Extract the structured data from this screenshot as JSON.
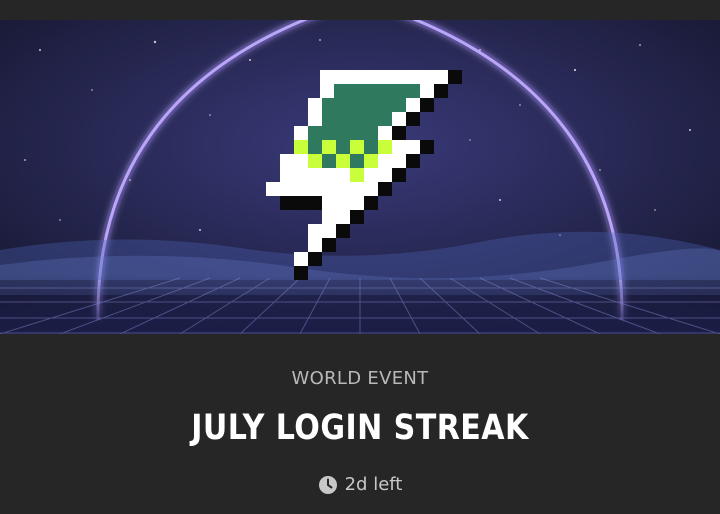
{
  "event": {
    "category": "WORLD EVENT",
    "title": "JULY LOGIN STREAK",
    "time_left": "2d left",
    "time_icon": "clock-icon"
  },
  "banner": {
    "icon": "lightning-bolt-icon",
    "colors": {
      "sky_top": "#1a1c3a",
      "sky_mid": "#2c2c66",
      "arc_glow": "#c7b8ff",
      "bolt_white": "#ffffff",
      "bolt_teal": "#2f7a5e",
      "bolt_lime": "#c9ff3a",
      "grid": "#8a8cd8"
    }
  }
}
